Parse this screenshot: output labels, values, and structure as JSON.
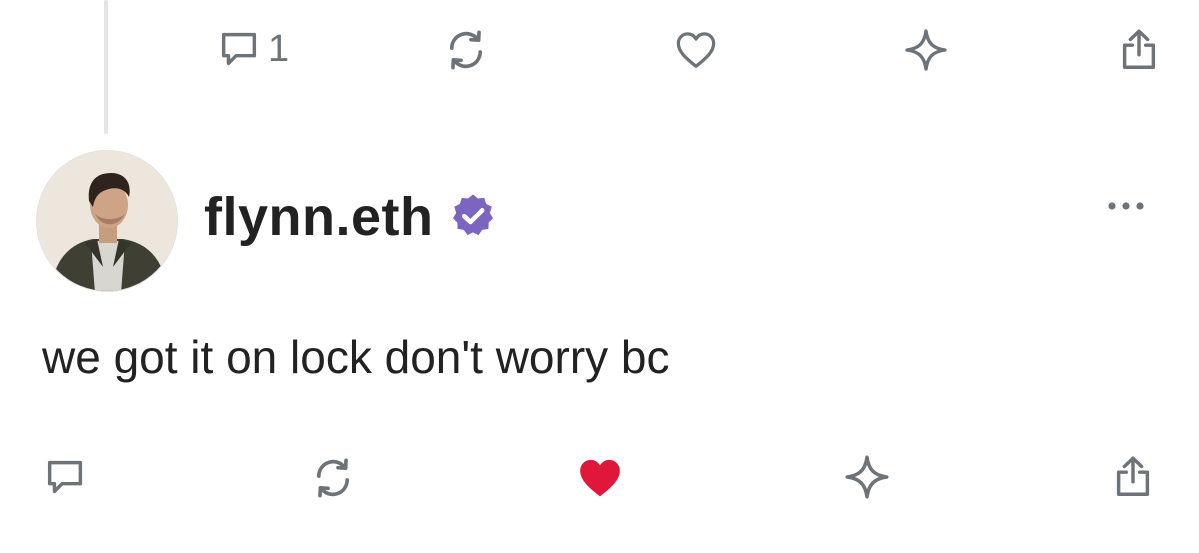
{
  "prev_post": {
    "actions": {
      "reply": {
        "icon": "reply-icon",
        "count": "1"
      },
      "repost": {
        "icon": "repost-icon"
      },
      "like": {
        "icon": "heart-outline-icon",
        "liked": false
      },
      "tip": {
        "icon": "sparkle-icon"
      },
      "share": {
        "icon": "share-icon"
      }
    }
  },
  "post": {
    "author": {
      "name": "flynn.eth",
      "verified": true,
      "badge_color": "#7c65c1"
    },
    "text": "we got it on lock don't worry bc",
    "actions": {
      "reply": {
        "icon": "reply-icon"
      },
      "repost": {
        "icon": "repost-icon"
      },
      "like": {
        "icon": "heart-filled-icon",
        "liked": true,
        "color": "#e0173b"
      },
      "tip": {
        "icon": "sparkle-icon"
      },
      "share": {
        "icon": "share-icon"
      }
    }
  },
  "colors": {
    "icon_gray": "#6e7378",
    "text": "#222222",
    "thread_line": "#e4e5e7"
  }
}
